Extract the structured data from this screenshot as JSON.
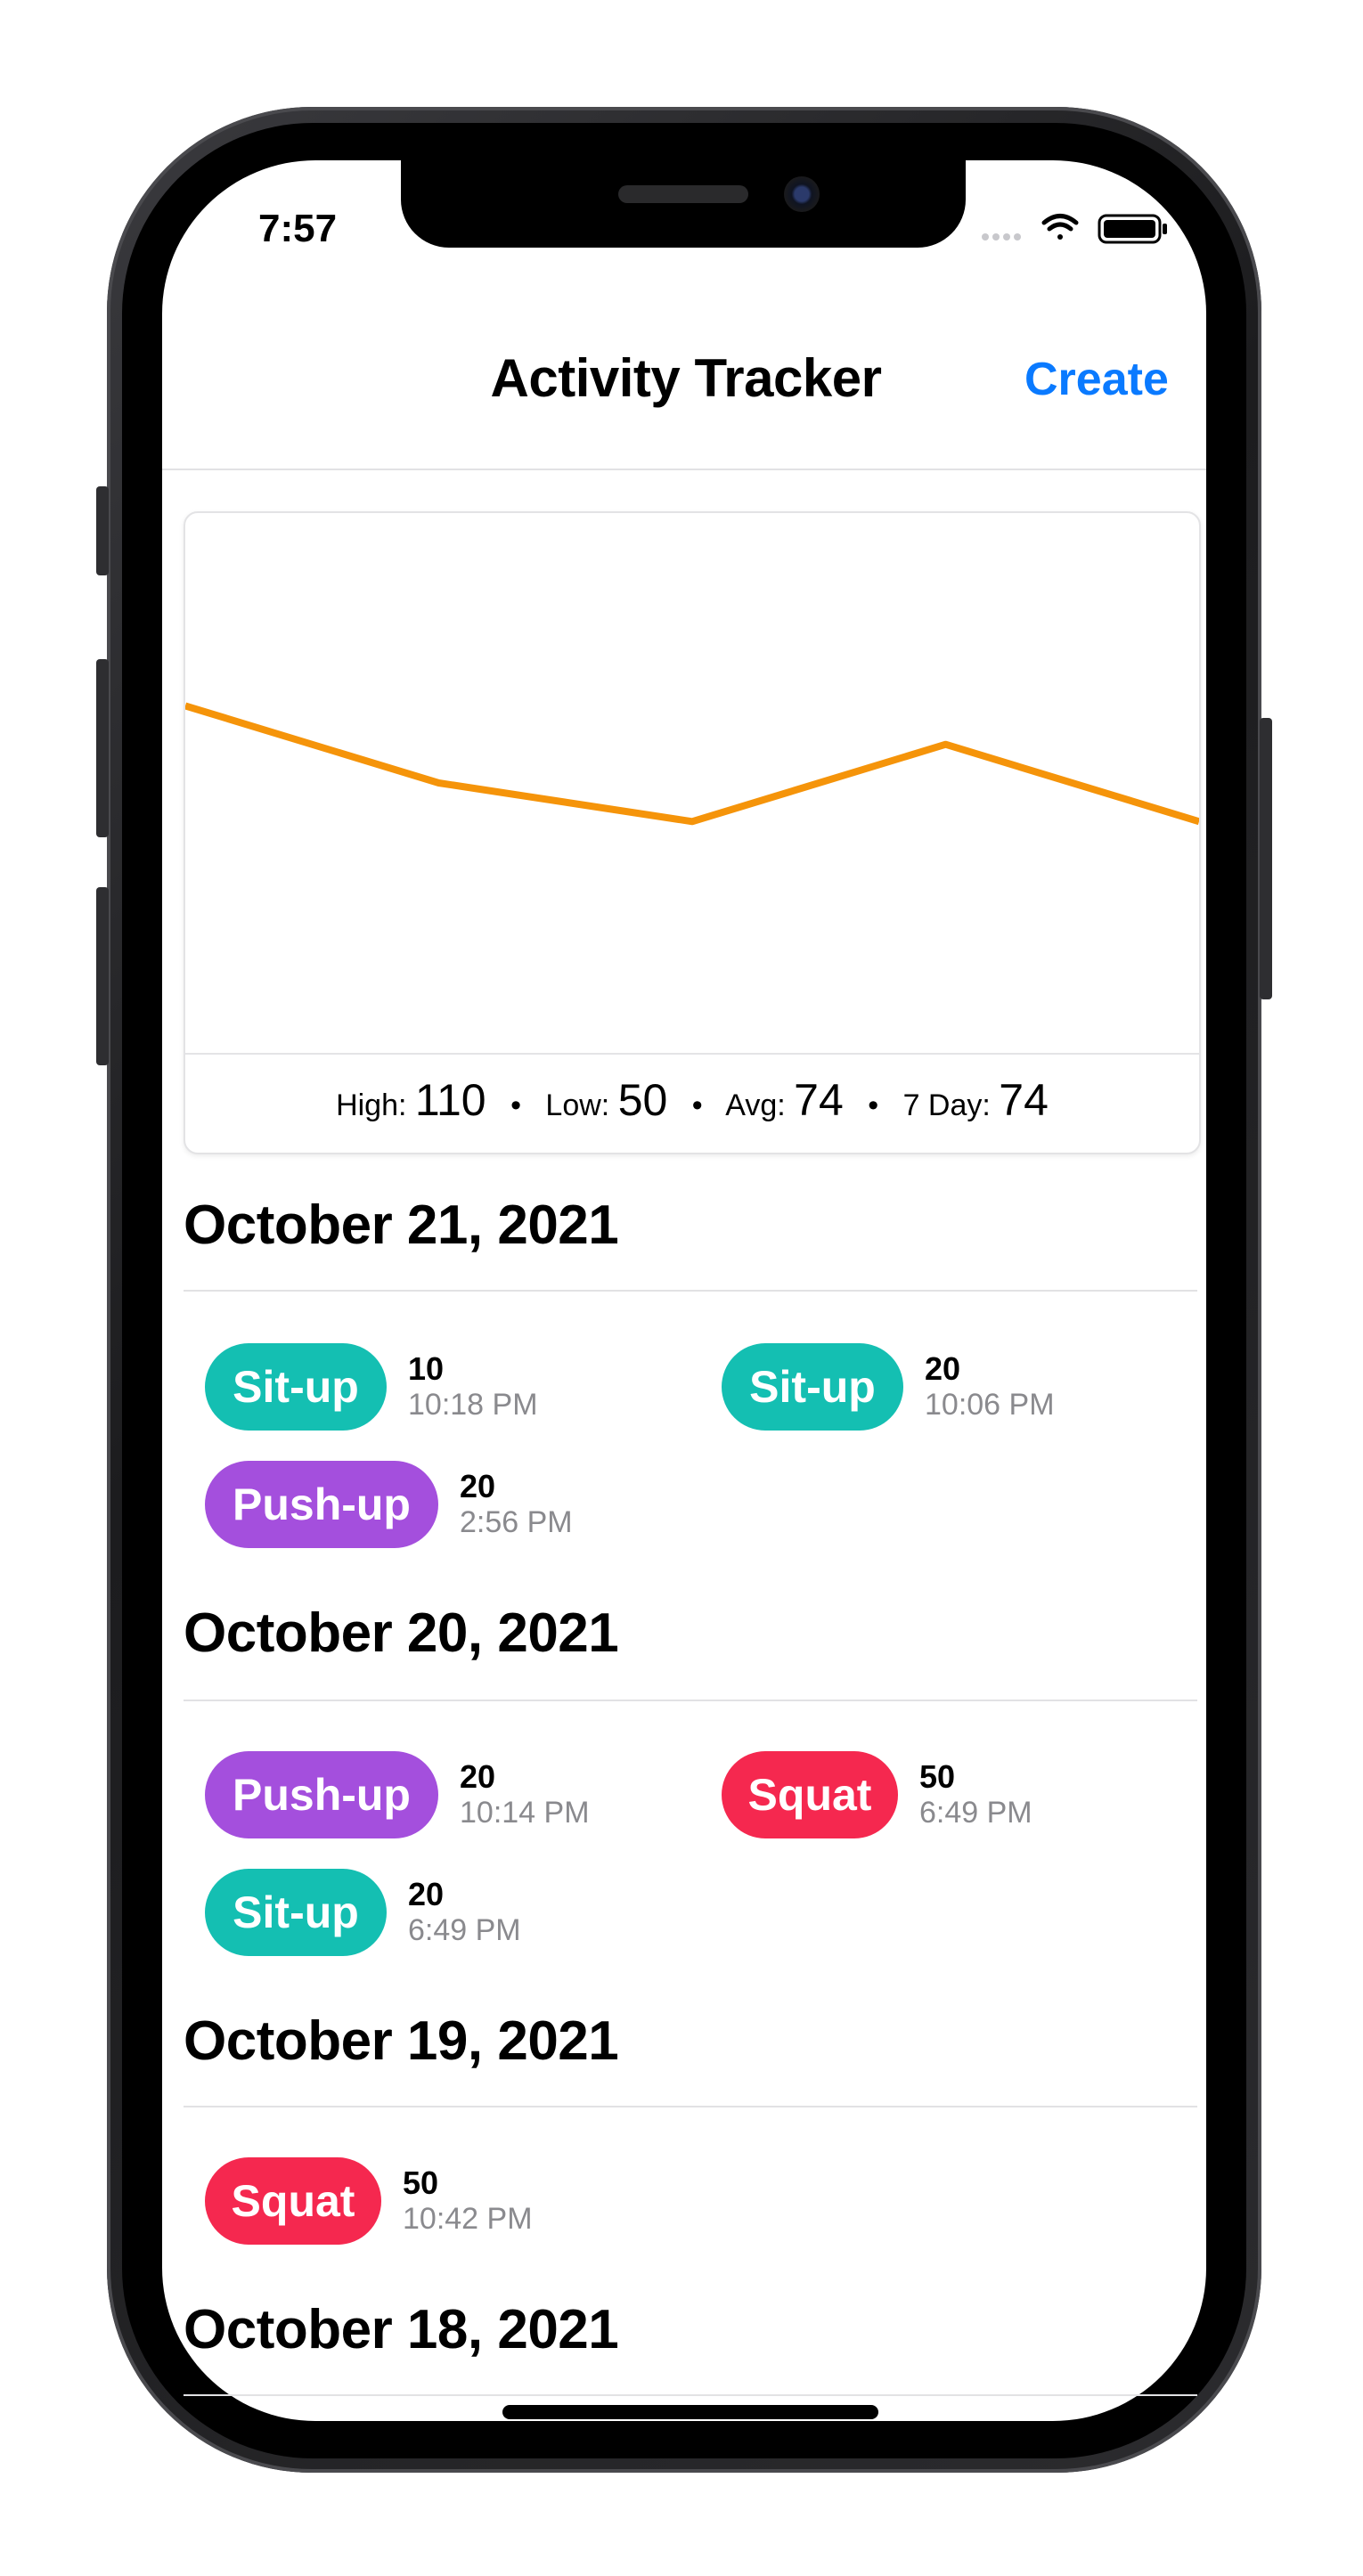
{
  "status_bar": {
    "time": "7:57"
  },
  "nav": {
    "title": "Activity Tracker",
    "create_label": "Create"
  },
  "chart_data": {
    "type": "line",
    "title": "",
    "series": [
      {
        "values": [
          90,
          70,
          60,
          80,
          60
        ]
      }
    ],
    "ylim": [
      0,
      140
    ],
    "color": "#f5940a",
    "grid": false
  },
  "stats": {
    "high_label": "High:",
    "high_value": "110",
    "low_label": "Low:",
    "low_value": "50",
    "avg_label": "Avg:",
    "avg_value": "74",
    "week_label": "7 Day:",
    "week_value": "74",
    "separator": "•"
  },
  "colors": {
    "situp": "#14bfb2",
    "pushup": "#a44fdd",
    "squat": "#f5284f"
  },
  "sections": [
    {
      "date": "October 21, 2021",
      "entries": [
        {
          "activity": "Sit-up",
          "count": "10",
          "time": "10:18 PM"
        },
        {
          "activity": "Sit-up",
          "count": "20",
          "time": "10:06 PM"
        },
        {
          "activity": "Push-up",
          "count": "20",
          "time": "2:56 PM"
        }
      ]
    },
    {
      "date": "October 20, 2021",
      "entries": [
        {
          "activity": "Push-up",
          "count": "20",
          "time": "10:14 PM"
        },
        {
          "activity": "Squat",
          "count": "50",
          "time": "6:49 PM"
        },
        {
          "activity": "Sit-up",
          "count": "20",
          "time": "6:49 PM"
        }
      ]
    },
    {
      "date": "October 19, 2021",
      "entries": [
        {
          "activity": "Squat",
          "count": "50",
          "time": "10:42 PM"
        }
      ]
    },
    {
      "date": "October 18, 2021",
      "entries": []
    }
  ]
}
